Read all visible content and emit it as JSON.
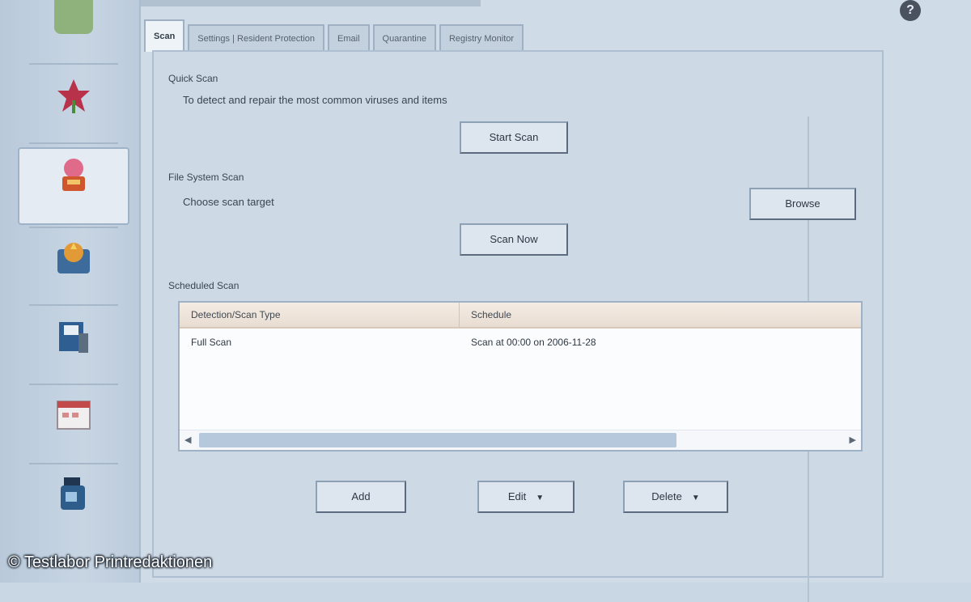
{
  "sidebar": {
    "items": [
      {
        "label": "",
        "icon": "home-icon",
        "color": "#7aa36a"
      },
      {
        "label": "",
        "icon": "flower-icon",
        "color": "#b8324a"
      },
      {
        "label": "",
        "icon": "tools-icon",
        "color": "#d0562e",
        "active": true
      },
      {
        "label": "",
        "icon": "shield-icon",
        "color": "#d98a2b"
      },
      {
        "label": "",
        "icon": "disk-icon",
        "color": "#3b6fa5"
      },
      {
        "label": "",
        "icon": "calendar-icon",
        "color": "#c24a4a"
      },
      {
        "label": "",
        "icon": "bottle-icon",
        "color": "#2e5d8c"
      }
    ]
  },
  "header": {
    "help_glyph": "?"
  },
  "tabs": [
    {
      "label": "Scan",
      "active": true
    },
    {
      "label": "Settings | Resident Protection"
    },
    {
      "label": "Email"
    },
    {
      "label": "Quarantine"
    },
    {
      "label": "Registry Monitor"
    }
  ],
  "quick_scan": {
    "group_label": "Quick Scan",
    "description": "To detect and repair the most common viruses and items",
    "button_label": "Start Scan"
  },
  "file_scan": {
    "group_label": "File System Scan",
    "description": "Choose scan target",
    "browse_label": "Browse",
    "button_label": "Scan Now"
  },
  "scheduled": {
    "group_label": "Scheduled Scan",
    "columns": [
      "Detection/Scan Type",
      "Schedule"
    ],
    "rows": [
      {
        "type": "Full Scan",
        "schedule": "Scan at 00:00 on 2006-11-28"
      }
    ]
  },
  "actions": {
    "add_label": "Add",
    "edit_label": "Edit",
    "delete_label": "Delete"
  },
  "watermark": "© Testlabor Printredaktionen"
}
